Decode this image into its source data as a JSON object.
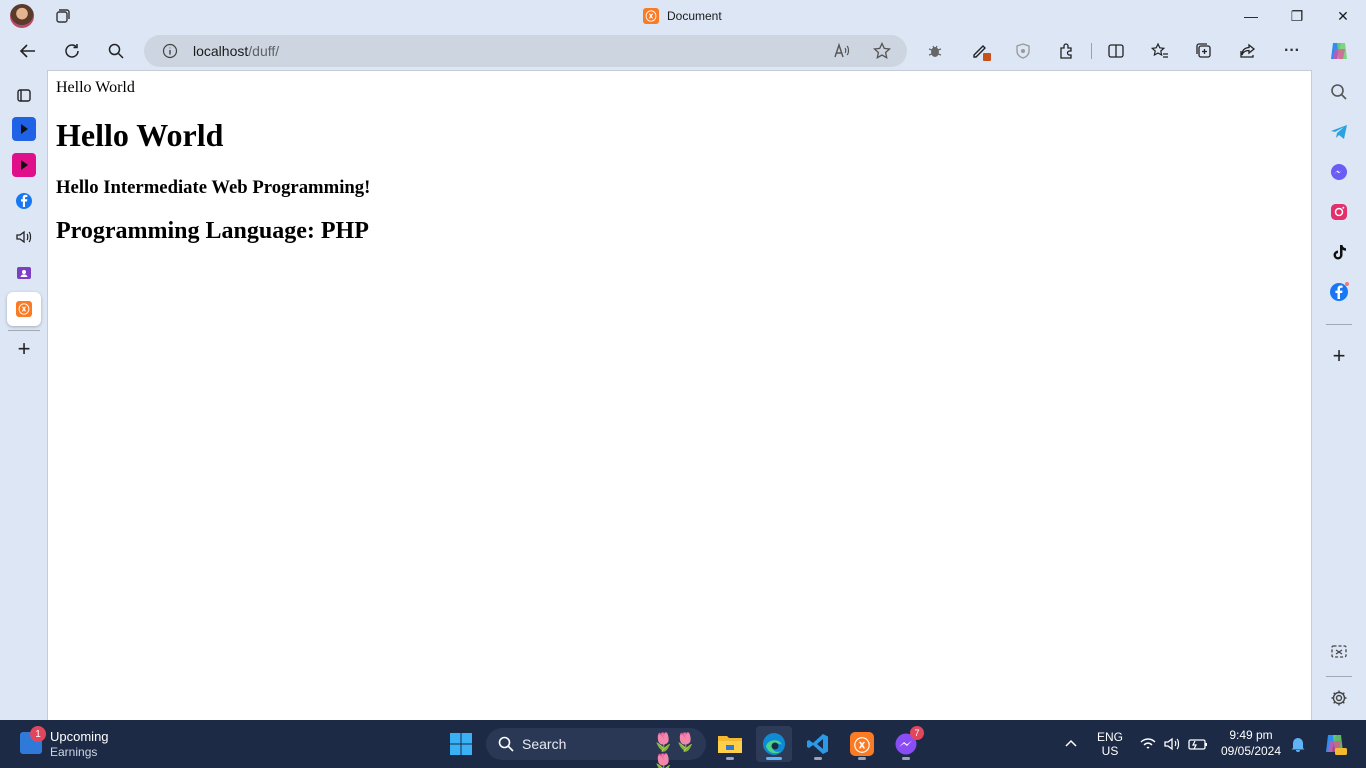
{
  "window": {
    "title": "Document",
    "controls": {
      "minimize": "—",
      "maximize": "❐",
      "close": "✕"
    }
  },
  "toolbar": {
    "back_icon": "arrow-left",
    "refresh_icon": "refresh",
    "search_icon": "search",
    "url_host": "localhost",
    "url_path": "/duff/",
    "read_aloud_icon": "read-aloud",
    "favorite_icon": "star",
    "extensions_icon": "puzzle",
    "split_screen_icon": "split",
    "favorites_icon": "star-list",
    "collections_icon": "collections",
    "share_icon": "share",
    "more_label": "···"
  },
  "page": {
    "line": "Hello World",
    "h1": "Hello World",
    "h3": "Hello Intermediate Web Programming!",
    "h2": "Programming Language: PHP"
  },
  "left_sidebar": {
    "items": [
      "tab-actions",
      "video-app-blue",
      "video-app-pink",
      "facebook",
      "read-aloud",
      "contacts",
      "xampp-tab"
    ],
    "add_label": "+"
  },
  "right_sidebar": {
    "items": [
      "search",
      "telegram",
      "messenger",
      "instagram",
      "tiktok",
      "facebook"
    ],
    "add_label": "+"
  },
  "taskbar": {
    "weather_title": "Upcoming",
    "weather_subtitle": "Earnings",
    "weather_badge": "1",
    "search_placeholder": "Search",
    "messenger_badge": "7",
    "lang_top": "ENG",
    "lang_bottom": "US",
    "time": "9:49 pm",
    "date": "09/05/2024"
  },
  "colors": {
    "chrome_bg": "#dce6f5",
    "address_bg": "#cdd5e0",
    "taskbar_bg": "#1c2a45",
    "xampp_orange": "#fb7a24"
  }
}
